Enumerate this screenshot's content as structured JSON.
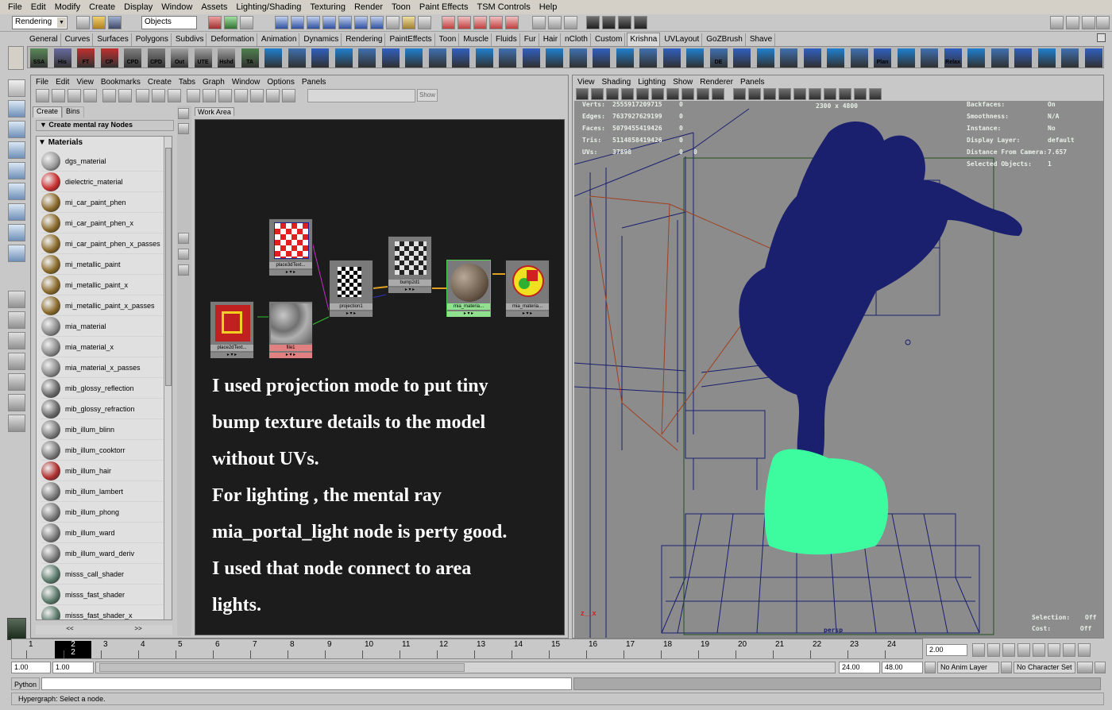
{
  "menubar": [
    "File",
    "Edit",
    "Modify",
    "Create",
    "Display",
    "Window",
    "Assets",
    "Lighting/Shading",
    "Texturing",
    "Render",
    "Toon",
    "Paint Effects",
    "TSM Controls",
    "Help"
  ],
  "status": {
    "menu_set": "Rendering",
    "object_field": "Objects"
  },
  "shelf_tabs": [
    "General",
    "Curves",
    "Surfaces",
    "Polygons",
    "Subdivs",
    "Deformation",
    "Animation",
    "Dynamics",
    "Rendering",
    "PaintEffects",
    "Toon",
    "Muscle",
    "Fluids",
    "Fur",
    "Hair",
    "nCloth",
    "Custom",
    "Krishna",
    "UVLayout",
    "GoZBrush",
    "Shave"
  ],
  "active_shelf_tab": "Krishna",
  "shelf_buttons": [
    "SSA",
    "His",
    "FT",
    "CP",
    "CPD",
    "CPD",
    "Out",
    "UTE",
    "Hshd",
    "TA",
    "",
    "",
    "",
    "",
    "",
    "",
    "",
    "",
    "",
    "",
    "",
    "",
    "",
    "",
    "",
    "",
    "",
    "",
    "",
    "DE",
    "",
    "",
    "",
    "",
    "",
    "",
    "Plan",
    "",
    "",
    "Relax",
    "",
    "",
    "",
    "",
    "",
    ""
  ],
  "hypershade": {
    "menu": [
      "File",
      "Edit",
      "View",
      "Bookmarks",
      "Create",
      "Tabs",
      "Graph",
      "Window",
      "Options",
      "Panels"
    ],
    "show_label": "Show",
    "tabs": [
      "Create",
      "Bins"
    ],
    "create_header": "Create mental ray Nodes",
    "materials_header": "Materials",
    "work_area_tab": "Work Area",
    "materials": [
      {
        "name": "dgs_material",
        "color": "#9a9a9a"
      },
      {
        "name": "dielectric_material",
        "color": "#c83030"
      },
      {
        "name": "mi_car_paint_phen",
        "color": "#8a6a2a"
      },
      {
        "name": "mi_car_paint_phen_x",
        "color": "#8a6a2a"
      },
      {
        "name": "mi_car_paint_phen_x_passes",
        "color": "#8a6a2a"
      },
      {
        "name": "mi_metallic_paint",
        "color": "#8a6a2a"
      },
      {
        "name": "mi_metallic_paint_x",
        "color": "#8a6a2a"
      },
      {
        "name": "mi_metallic_paint_x_passes",
        "color": "#8a6a2a"
      },
      {
        "name": "mia_material",
        "color": "#8a8a8a"
      },
      {
        "name": "mia_material_x",
        "color": "#8a8a8a"
      },
      {
        "name": "mia_material_x_passes",
        "color": "#8a8a8a"
      },
      {
        "name": "mib_glossy_reflection",
        "color": "#6a6a6a"
      },
      {
        "name": "mib_glossy_refraction",
        "color": "#6a6a6a"
      },
      {
        "name": "mib_illum_blinn",
        "color": "#7a7a7a"
      },
      {
        "name": "mib_illum_cooktorr",
        "color": "#7a7a7a"
      },
      {
        "name": "mib_illum_hair",
        "color": "#b03030"
      },
      {
        "name": "mib_illum_lambert",
        "color": "#7a7a7a"
      },
      {
        "name": "mib_illum_phong",
        "color": "#7a7a7a"
      },
      {
        "name": "mib_illum_ward",
        "color": "#7a7a7a"
      },
      {
        "name": "mib_illum_ward_deriv",
        "color": "#7a7a7a"
      },
      {
        "name": "misss_call_shader",
        "color": "#5a7a6a"
      },
      {
        "name": "misss_fast_shader",
        "color": "#5a7a6a"
      },
      {
        "name": "misss_fast_shader_x",
        "color": "#5a7a6a"
      }
    ],
    "scroll_left": "<<",
    "scroll_right": ">>",
    "nodes": [
      "place3dText...",
      "place2dText...",
      "file1",
      "projection1",
      "bump2d1",
      "mia_materia...",
      "mia_materia..."
    ],
    "overlay_lines": [
      "I used projection mode to put tiny",
      "bump texture details to the model",
      "without UVs.",
      "For lighting , the mental ray",
      "mia_portal_light node is perty good.",
      "I used that node connect to area",
      "lights."
    ]
  },
  "viewport": {
    "menu": [
      "View",
      "Shading",
      "Lighting",
      "Show",
      "Renderer",
      "Panels"
    ],
    "hud_left": [
      [
        "Verts:",
        "2555917209715",
        "0"
      ],
      [
        "Edges:",
        "7637927629199",
        "0"
      ],
      [
        "Faces:",
        "5079455419426",
        "0"
      ],
      [
        "Tris:",
        "5114858419426",
        "0"
      ],
      [
        "UVs:",
        "37898",
        "0",
        "0"
      ]
    ],
    "resolution": "2300 x 4800",
    "hud_right": [
      [
        "Backfaces:",
        "On"
      ],
      [
        "Smoothness:",
        "N/A"
      ],
      [
        "Instance:",
        "No"
      ],
      [
        "Display Layer:",
        "default"
      ],
      [
        "Distance From Camera:",
        "7.657"
      ],
      [
        "Selected Objects:",
        "1"
      ]
    ],
    "camera_label": "persp",
    "selection_label": "Selection:",
    "selection_value": "Off",
    "cost_label": "Cost:",
    "cost_value": "Off",
    "bg_color": "#8c8c8c",
    "silhouette_color": "#1a1f6e",
    "highlight_color": "#3dfca0"
  },
  "timeline": {
    "ticks": [
      "1",
      "2",
      "3",
      "4",
      "5",
      "6",
      "7",
      "8",
      "9",
      "10",
      "11",
      "12",
      "13",
      "14",
      "15",
      "16",
      "17",
      "18",
      "19",
      "20",
      "21",
      "22",
      "23",
      "24"
    ],
    "current_frame": "2",
    "current_field": "2.00"
  },
  "range": {
    "start": "1.00",
    "playback_start": "1.00",
    "playback_end": "24.00",
    "end": "48.00",
    "anim_layer": "No Anim Layer",
    "char_set": "No Character Set"
  },
  "command": {
    "label": "Python"
  },
  "help_line": "Hypergraph: Select a node."
}
